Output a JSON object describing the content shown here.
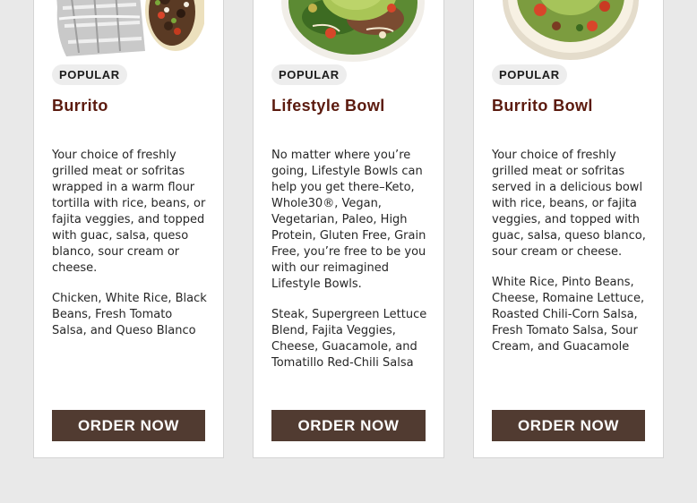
{
  "cards": [
    {
      "badge": "POPULAR",
      "title": "Burrito",
      "description": "Your choice of freshly grilled meat or sofritas wrapped in a warm flour tortilla with rice, beans, or fajita veggies, and topped with guac, salsa, queso blanco, sour cream or cheese.",
      "ingredients": "Chicken, White Rice, Black Beans, Fresh Tomato Salsa, and Queso Blanco",
      "cta": "ORDER NOW",
      "image": "burrito-foil-wrapped"
    },
    {
      "badge": "POPULAR",
      "title": "Lifestyle Bowl",
      "description": "No matter where you’re going, Lifestyle Bowls can help you get there–Keto, Whole30®, Vegan, Vegetarian, Paleo, High Protein, Gluten Free, Grain Free, you’re free to be you with our reimagined Lifestyle Bowls.",
      "ingredients": "Steak, Supergreen Lettuce Blend, Fajita Veggies, Cheese, Guacamole, and Tomatillo Red-Chili Salsa",
      "cta": "ORDER NOW",
      "image": "lifestyle-bowl-greens"
    },
    {
      "badge": "POPULAR",
      "title": "Burrito Bowl",
      "description": "Your choice of freshly grilled meat or sofritas served in a delicious bowl with rice, beans, or fajita veggies, and topped with guac, salsa, queso blanco, sour cream or cheese.",
      "ingredients": "White Rice, Pinto Beans, Cheese, Romaine Lettuce, Roasted Chili-Corn Salsa, Fresh Tomato Salsa, Sour Cream, and Guacamole",
      "cta": "ORDER NOW",
      "image": "burrito-bowl"
    }
  ],
  "colors": {
    "page_background": "#e9e9e9",
    "title": "#5b1a0e",
    "button": "#513b31",
    "badge_background": "#ededed"
  }
}
